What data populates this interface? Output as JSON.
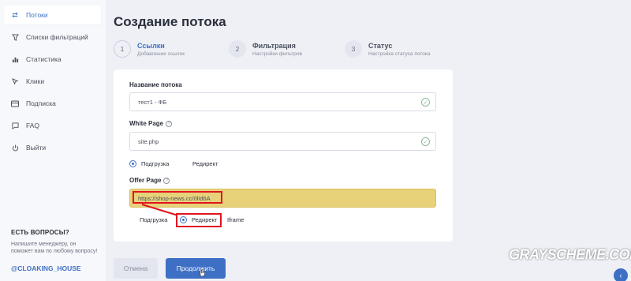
{
  "sidebar": {
    "items": [
      {
        "label": "Потоки",
        "icon": "sync-icon",
        "active": true
      },
      {
        "label": "Списки фильтраций",
        "icon": "filter-icon",
        "active": false
      },
      {
        "label": "Статистика",
        "icon": "bar-chart-icon",
        "active": false
      },
      {
        "label": "Клики",
        "icon": "cursor-icon",
        "active": false
      },
      {
        "label": "Подписка",
        "icon": "card-icon",
        "active": false
      },
      {
        "label": "FAQ",
        "icon": "chat-icon",
        "active": false
      },
      {
        "label": "Выйти",
        "icon": "power-icon",
        "active": false
      }
    ],
    "help_title": "ЕСТЬ ВОПРОСЫ?",
    "help_text": "Напишите менеджеру, он поможет вам по любому вопросу!",
    "help_handle": "@CLOAKING_HOUSE"
  },
  "main": {
    "title": "Создание потока",
    "steps": [
      {
        "number": "1",
        "label": "Ссылки",
        "sub": "Добавление ссылок"
      },
      {
        "number": "2",
        "label": "Фильтрация",
        "sub": "Настройки фильтров"
      },
      {
        "number": "3",
        "label": "Статус",
        "sub": "Настройка статуса потока"
      }
    ],
    "form": {
      "name_label": "Название потока",
      "name_value": "тест1 - ФБ",
      "white_label": "White Page",
      "white_value": "site.php",
      "white_options": [
        "Подгрузка",
        "Редирект"
      ],
      "white_selected": "Подгрузка",
      "offer_label": "Offer Page",
      "offer_value": "https://shop-news.cc/0lId6A",
      "offer_options": [
        "Подгрузка",
        "Редирект",
        "Iframe"
      ],
      "offer_selected": "Редирект"
    },
    "buttons": {
      "cancel": "Отмена",
      "continue": "Продолжить"
    }
  },
  "watermark": "GRAYSCHEME.COM",
  "colors": {
    "accent": "#3d6fc4",
    "highlight": "#e1141e",
    "offer_bg": "#e7d27a"
  }
}
